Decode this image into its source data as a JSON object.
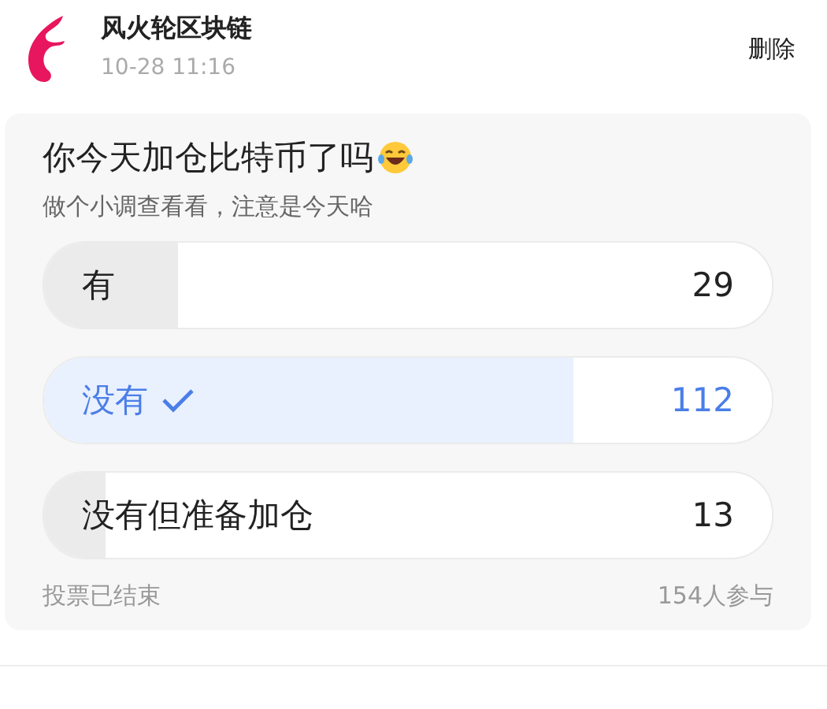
{
  "post": {
    "author": "风火轮区块链",
    "time": "10-28 11:16",
    "action": "删除"
  },
  "poll": {
    "title": "你今天加仓比特币了吗",
    "subtitle": "做个小调查看看，注意是今天哈",
    "options": [
      {
        "label": "有",
        "count": "29",
        "level": 0.185,
        "selected": false
      },
      {
        "label": "没有",
        "count": "112",
        "level": 0.727,
        "selected": true
      },
      {
        "label": "没有但准备加仓",
        "count": "13",
        "level": 0.084,
        "selected": false
      }
    ],
    "status": "投票已结束",
    "participants": "154人参与"
  }
}
